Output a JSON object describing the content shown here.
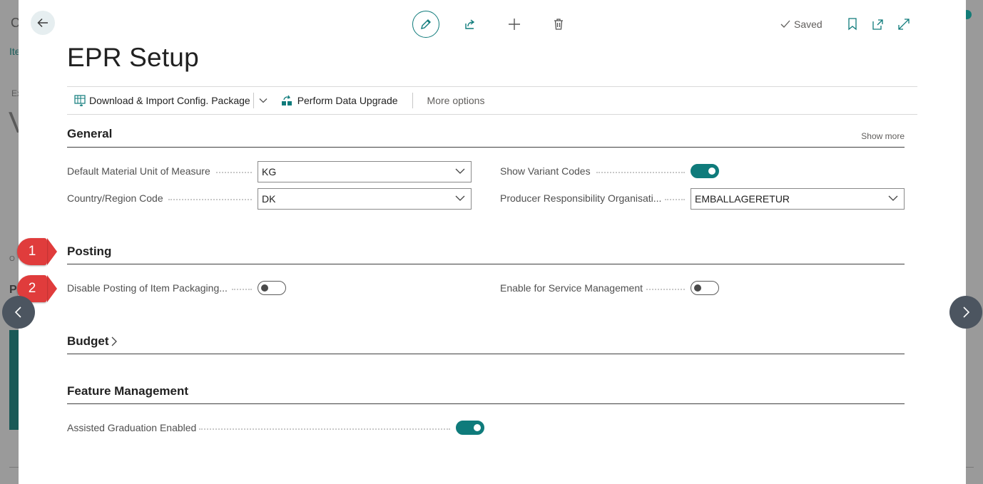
{
  "background": {
    "title": "C",
    "link": "Ite",
    "small": "Ex",
    "big": "V",
    "tiny": "O",
    "bold": "P"
  },
  "dialog": {
    "title": "EPR Setup",
    "status": "Saved"
  },
  "actions": {
    "download_import": "Download & Import Config. Package",
    "perform_upgrade": "Perform Data Upgrade",
    "more_options": "More options"
  },
  "general": {
    "title": "General",
    "show_more": "Show more",
    "default_uom_label": "Default Material Unit of Measure",
    "default_uom_value": "KG",
    "country_label": "Country/Region Code",
    "country_value": "DK",
    "show_variant_label": "Show Variant Codes",
    "show_variant_value": true,
    "pro_label": "Producer Responsibility Organisati...",
    "pro_value": "EMBALLAGERETUR"
  },
  "posting": {
    "title": "Posting",
    "disable_posting_label": "Disable Posting of Item Packaging...",
    "disable_posting_value": false,
    "enable_service_label": "Enable for Service Management",
    "enable_service_value": false
  },
  "budget": {
    "title": "Budget"
  },
  "feature_management": {
    "title": "Feature Management",
    "assisted_label": "Assisted Graduation Enabled",
    "assisted_value": true
  },
  "callouts": {
    "one": "1",
    "two": "2",
    "color": "#e03c3c"
  },
  "colors": {
    "accent": "#0f7b7b",
    "nav": "#4c5560"
  }
}
